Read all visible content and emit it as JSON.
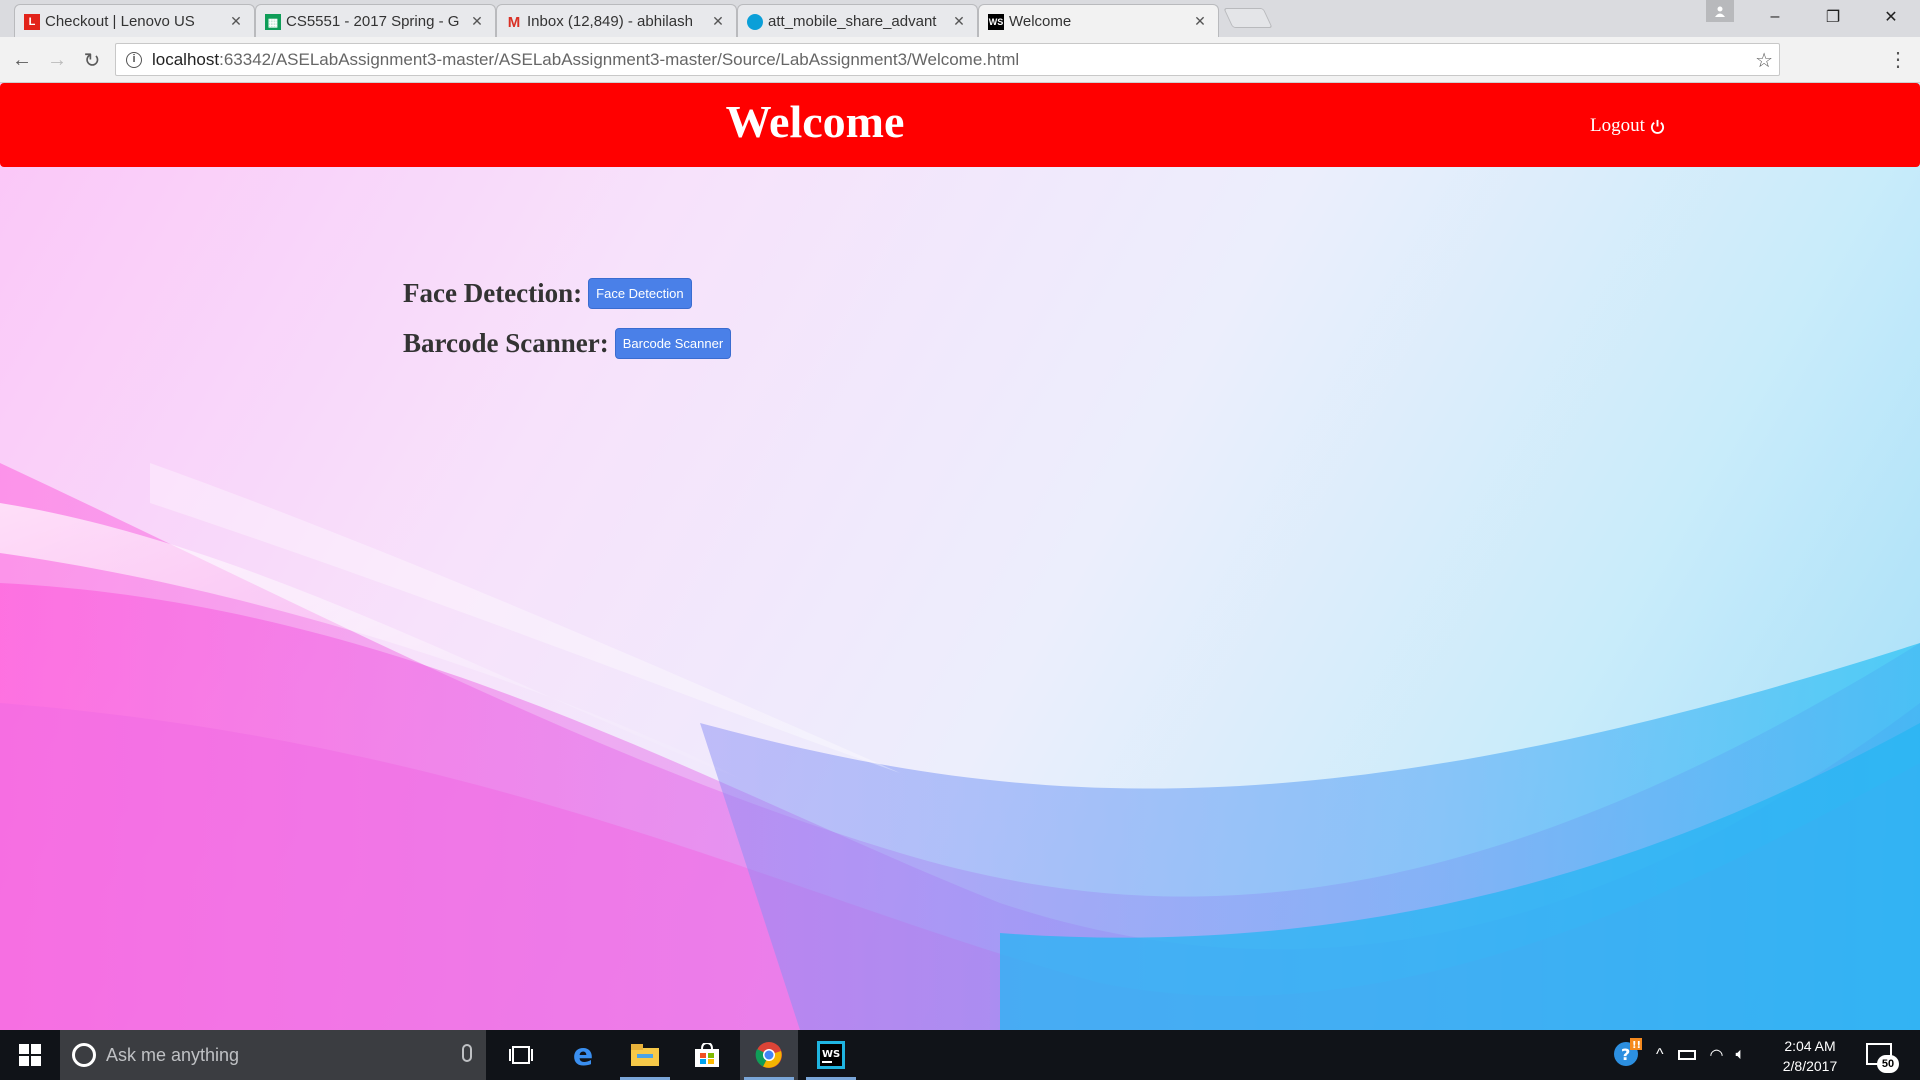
{
  "browser": {
    "tabs": [
      {
        "title": "Checkout | Lenovo US",
        "favicon": "lenovo-icon",
        "color": "#e2231a"
      },
      {
        "title": "CS5551 - 2017 Spring - G",
        "favicon": "sheets-icon",
        "color": "#0f9d58"
      },
      {
        "title": "Inbox (12,849) - abhilash",
        "favicon": "gmail-icon",
        "color": "#d93025"
      },
      {
        "title": "att_mobile_share_advant",
        "favicon": "att-icon",
        "color": "#0b9fd8"
      },
      {
        "title": "Welcome",
        "favicon": "webstorm-icon",
        "color": "#000000"
      }
    ],
    "active_tab_index": 4,
    "url_host": "localhost",
    "url_rest": ":63342/ASELabAssignment3-master/ASELabAssignment3-master/Source/LabAssignment3/Welcome.html"
  },
  "page": {
    "title": "Welcome",
    "logout_label": "Logout",
    "header_color": "#ff0000",
    "features": [
      {
        "label": "Face Detection:",
        "button": "Face Detection"
      },
      {
        "label": "Barcode Scanner:",
        "button": "Barcode Scanner"
      }
    ],
    "button_color": "#4a80e8"
  },
  "taskbar": {
    "search_placeholder": "Ask me anything",
    "time": "2:04 AM",
    "date": "2/8/2017",
    "notification_count": "50",
    "apps": [
      "task-view-icon",
      "edge-icon",
      "file-explorer-icon",
      "store-icon",
      "chrome-icon",
      "webstorm-icon"
    ]
  }
}
